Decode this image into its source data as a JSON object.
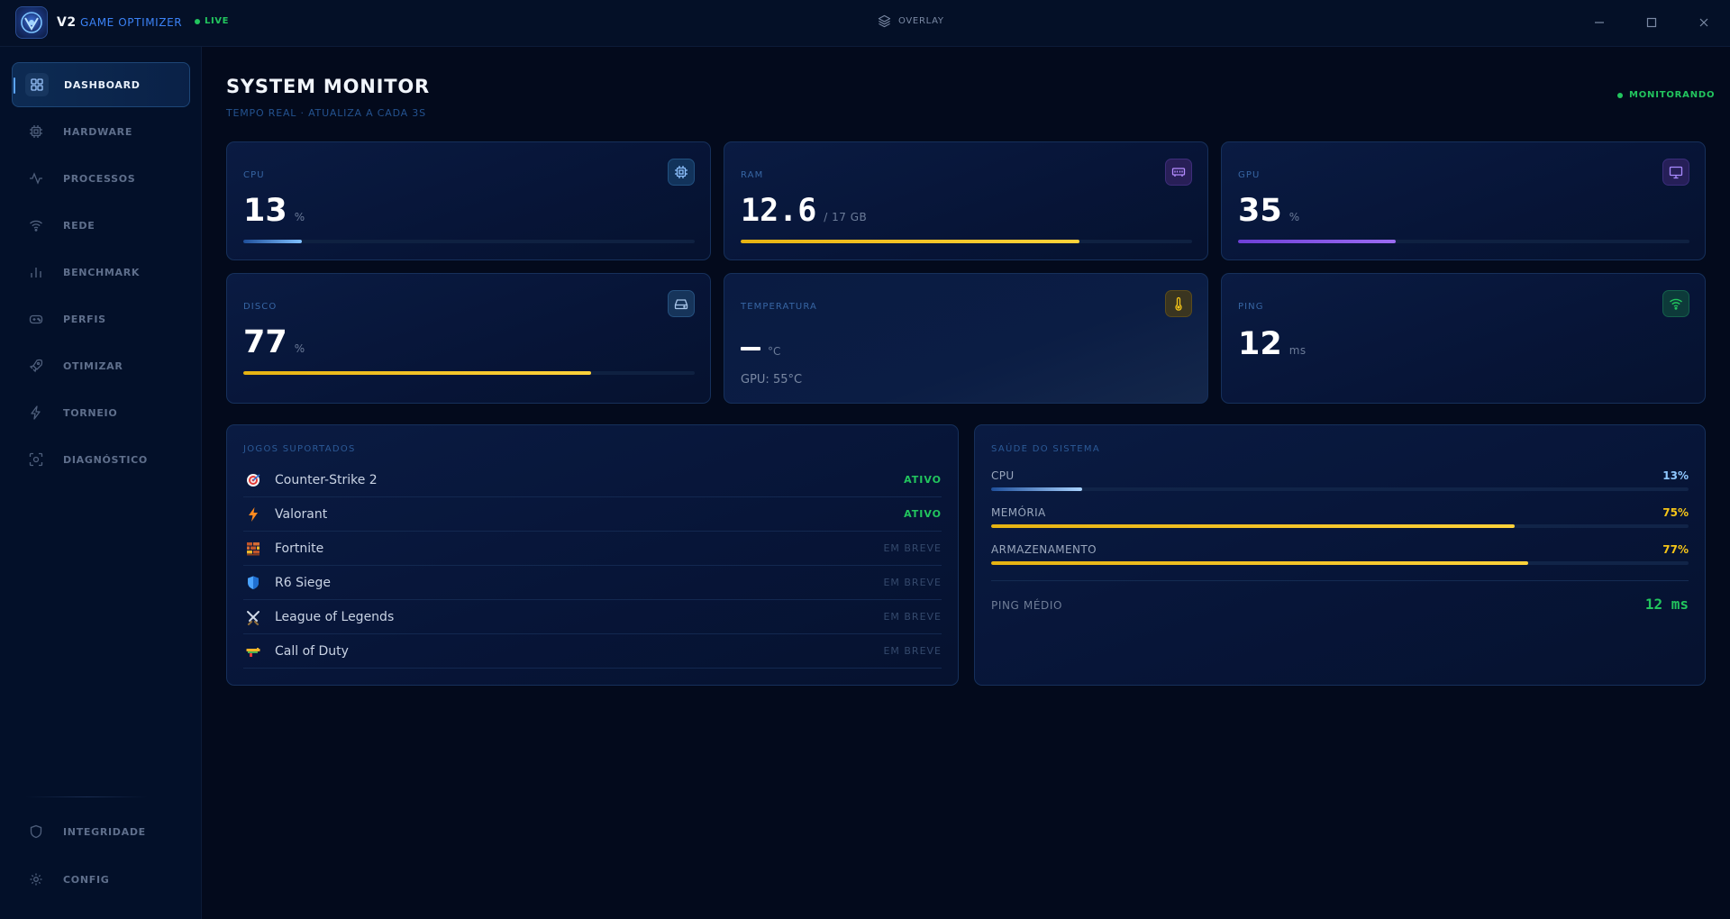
{
  "titlebar": {
    "app_short": "V2",
    "app_name": "GAME OPTIMIZER",
    "live_label": "LIVE",
    "overlay_label": "OVERLAY"
  },
  "sidebar": {
    "items": [
      {
        "label": "DASHBOARD",
        "icon": "dashboard-icon",
        "active": true
      },
      {
        "label": "HARDWARE",
        "icon": "chip-icon"
      },
      {
        "label": "PROCESSOS",
        "icon": "activity-icon"
      },
      {
        "label": "REDE",
        "icon": "wifi-icon"
      },
      {
        "label": "BENCHMARK",
        "icon": "bar-chart-icon"
      },
      {
        "label": "PERFIS",
        "icon": "gamepad-icon"
      },
      {
        "label": "OTIMIZAR",
        "icon": "rocket-icon"
      },
      {
        "label": "TORNEIO",
        "icon": "bolt-icon"
      },
      {
        "label": "DIAGNÓSTICO",
        "icon": "scan-icon"
      }
    ],
    "bottom_items": [
      {
        "label": "INTEGRIDADE",
        "icon": "shield-icon"
      },
      {
        "label": "CONFIG",
        "icon": "gear-icon"
      }
    ]
  },
  "header": {
    "title": "SYSTEM MONITOR",
    "subtitle": "TEMPO REAL · ATUALIZA A CADA 3S",
    "status": "MONITORANDO"
  },
  "stats": {
    "cpu": {
      "label": "CPU",
      "value": "13",
      "unit": "%",
      "progress": 0.13,
      "color": "#5aa9ff"
    },
    "ram": {
      "label": "RAM",
      "value": "12.6",
      "unit": "/ 17 GB",
      "progress": 0.75,
      "color": "#f5c518"
    },
    "gpu": {
      "label": "GPU",
      "value": "35",
      "unit": "%",
      "progress": 0.35,
      "color": "#8b5cf6"
    },
    "disk": {
      "label": "DISCO",
      "value": "77",
      "unit": "%",
      "progress": 0.77,
      "color": "#f5c518"
    },
    "temp": {
      "label": "TEMPERATURA",
      "unit": "°C",
      "sub": "GPU: 55°C"
    },
    "ping": {
      "label": "PING",
      "value": "12",
      "unit": "ms"
    }
  },
  "games": {
    "title": "JOGOS SUPORTADOS",
    "items": [
      {
        "name": "Counter-Strike 2",
        "status": "ATIVO",
        "icon": "target-icon"
      },
      {
        "name": "Valorant",
        "status": "ATIVO",
        "icon": "bolt-icon"
      },
      {
        "name": "Fortnite",
        "status": "EM BREVE",
        "icon": "brick-icon"
      },
      {
        "name": "R6 Siege",
        "status": "EM BREVE",
        "icon": "shield-icon"
      },
      {
        "name": "League of Legends",
        "status": "EM BREVE",
        "icon": "swords-icon"
      },
      {
        "name": "Call of Duty",
        "status": "EM BREVE",
        "icon": "gun-icon"
      }
    ]
  },
  "health": {
    "title": "SAÚDE DO SISTEMA",
    "rows": [
      {
        "label": "CPU",
        "value": "13%",
        "progress": 0.13,
        "color": "#5aa9ff"
      },
      {
        "label": "MEMÓRIA",
        "value": "75%",
        "progress": 0.75,
        "color": "#f5c518"
      },
      {
        "label": "ARMAZENAMENTO",
        "value": "77%",
        "progress": 0.77,
        "color": "#f5c518"
      }
    ],
    "ping_label": "PING MÉDIO",
    "ping_value": "12 ms"
  },
  "colors": {
    "accent": "#3b82f6",
    "success": "#22c55e",
    "warning": "#f5c518",
    "purple": "#8b5cf6"
  }
}
